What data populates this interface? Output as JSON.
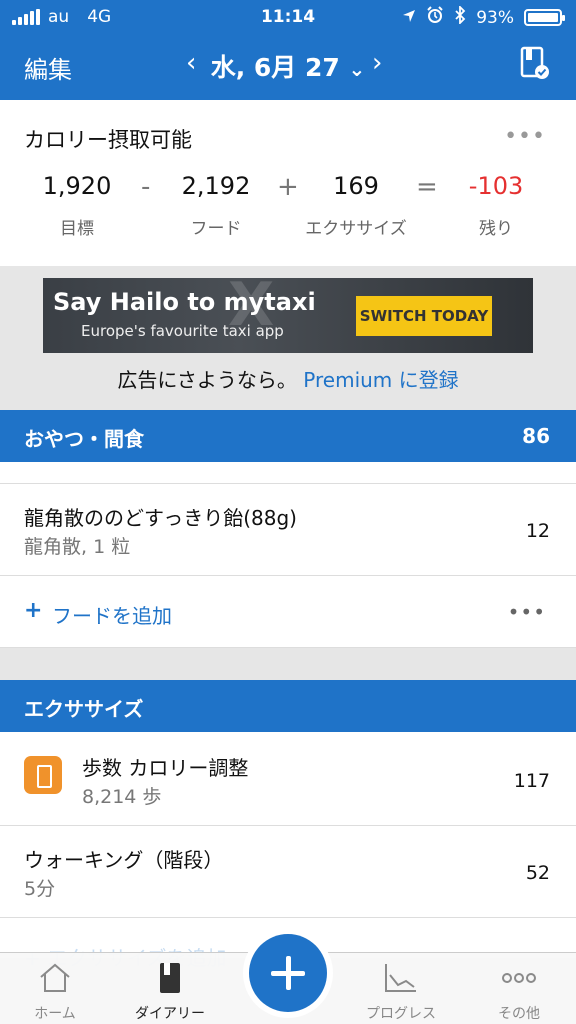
{
  "status": {
    "carrier": "au",
    "network": "4G",
    "time": "11:14",
    "battery": "93%"
  },
  "header": {
    "edit": "編集",
    "date": "水, 6月 27",
    "prev": "‹",
    "next": "›",
    "dropdown": "⌄"
  },
  "calories": {
    "title": "カロリー摂取可能",
    "more": "•••",
    "goal": "1,920",
    "goal_label": "目標",
    "op1": "-",
    "food": "2,192",
    "food_label": "フード",
    "op2": "+",
    "exercise": "169",
    "exercise_label": "エクササイズ",
    "op3": "=",
    "remaining": "-103",
    "remaining_label": "残り"
  },
  "ad": {
    "line1": "Say Hailo to mytaxi",
    "line2": "Europe's favourite taxi app",
    "cta": "SWITCH TODAY",
    "remove_text": "広告にさようなら。",
    "remove_link": "Premium に登録"
  },
  "snacks": {
    "title": "おやつ・間食",
    "total": "86",
    "items": [
      {
        "name": "龍角散ののどすっきり飴(88g)",
        "detail": "龍角散, 1 粒",
        "cal": "12"
      }
    ],
    "add_label": "フードを追加",
    "more": "•••"
  },
  "exercise": {
    "title": "エクササイズ",
    "items": [
      {
        "name": "歩数 カロリー調整",
        "detail": "8,214 歩",
        "cal": "117"
      },
      {
        "name": "ウォーキング（階段）",
        "detail": "5分",
        "cal": "52"
      }
    ],
    "add_label": "エクササイズを追加"
  },
  "tabs": [
    {
      "label": "ホーム"
    },
    {
      "label": "ダイアリー"
    },
    {
      "label": "プログレス"
    },
    {
      "label": "その他"
    }
  ],
  "colors": {
    "primary": "#1f73c8",
    "negative": "#e53030",
    "step_icon": "#f0922b",
    "ad_cta": "#f5c515"
  }
}
